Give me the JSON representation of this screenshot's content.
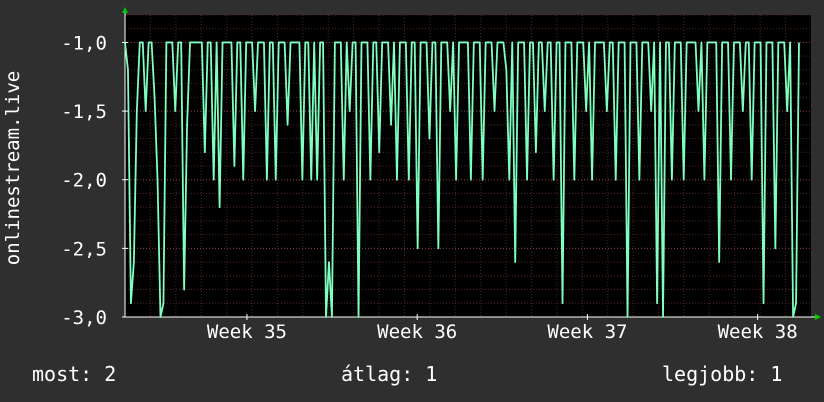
{
  "chart_data": {
    "type": "line",
    "ylabel": "onlinestream.live",
    "ylim": [
      -3.0,
      -0.8
    ],
    "yticks": [
      -1.0,
      -1.5,
      -2.0,
      -2.5,
      -3.0
    ],
    "ytick_labels": [
      "-1,0",
      "-1,5",
      "-2,0",
      "-2,5",
      "-3,0"
    ],
    "x_week_labels": [
      "Week 35",
      "Week 36",
      "Week 37",
      "Week 38"
    ],
    "xlim": [
      0,
      27
    ],
    "week_positions": [
      4.8,
      11.5,
      18.2,
      24.9
    ],
    "grid": true,
    "colors": {
      "background": "#2f2f2f",
      "plot": "#000000",
      "line": "#7fffbf",
      "grid": "#5a2a2a",
      "axis": "#ffffff",
      "arrow": "#00cc00"
    },
    "series": [
      {
        "values": [
          -1.0,
          -1.2,
          -2.9,
          -2.6,
          -1.5,
          -1.0,
          -1.0,
          -1.5,
          -1.0,
          -1.0,
          -1.4,
          -2.0,
          -3.0,
          -2.9,
          -1.0,
          -1.0,
          -1.0,
          -1.5,
          -1.0,
          -1.0,
          -2.8,
          -1.6,
          -1.0,
          -1.0,
          -1.0,
          -1.0,
          -1.0,
          -1.8,
          -1.0,
          -1.0,
          -2.0,
          -1.0,
          -2.2,
          -1.0,
          -1.0,
          -1.0,
          -1.0,
          -1.9,
          -1.0,
          -1.0,
          -2.0,
          -1.0,
          -1.0,
          -1.0,
          -1.5,
          -1.0,
          -1.0,
          -1.0,
          -2.0,
          -1.0,
          -1.0,
          -2.0,
          -1.0,
          -1.0,
          -1.0,
          -1.6,
          -1.0,
          -1.0,
          -1.0,
          -1.0,
          -2.0,
          -1.0,
          -1.0,
          -2.0,
          -1.0,
          -2.0,
          -1.0,
          -1.0,
          -3.0,
          -2.6,
          -3.0,
          -1.0,
          -1.0,
          -1.0,
          -2.0,
          -1.0,
          -1.5,
          -1.0,
          -1.0,
          -3.0,
          -1.0,
          -1.0,
          -1.0,
          -2.0,
          -1.0,
          -1.0,
          -1.8,
          -1.0,
          -1.0,
          -1.0,
          -1.6,
          -1.0,
          -2.0,
          -1.0,
          -1.0,
          -1.0,
          -2.0,
          -1.0,
          -1.0,
          -2.5,
          -1.0,
          -1.0,
          -1.0,
          -1.7,
          -1.0,
          -1.0,
          -2.5,
          -1.0,
          -1.0,
          -1.0,
          -1.5,
          -1.0,
          -2.0,
          -1.0,
          -1.0,
          -1.0,
          -1.0,
          -2.0,
          -1.0,
          -1.0,
          -1.0,
          -2.0,
          -1.0,
          -1.0,
          -1.0,
          -1.5,
          -1.0,
          -1.0,
          -1.0,
          -1.2,
          -2.0,
          -1.0,
          -2.6,
          -1.0,
          -1.0,
          -1.0,
          -2.0,
          -1.0,
          -1.0,
          -1.8,
          -1.0,
          -1.0,
          -1.5,
          -1.0,
          -1.0,
          -2.0,
          -1.0,
          -1.0,
          -2.9,
          -1.0,
          -1.0,
          -1.0,
          -2.0,
          -1.0,
          -1.0,
          -1.0,
          -1.5,
          -1.0,
          -2.0,
          -1.0,
          -1.0,
          -1.0,
          -1.0,
          -1.5,
          -1.0,
          -1.0,
          -2.0,
          -1.0,
          -1.0,
          -1.0,
          -3.0,
          -1.0,
          -1.0,
          -1.0,
          -2.0,
          -1.0,
          -1.0,
          -1.0,
          -1.5,
          -1.0,
          -2.9,
          -1.0,
          -3.0,
          -1.0,
          -1.0,
          -2.0,
          -1.0,
          -1.0,
          -1.0,
          -2.0,
          -1.0,
          -1.0,
          -1.0,
          -1.0,
          -1.5,
          -1.0,
          -2.0,
          -1.0,
          -1.0,
          -1.0,
          -1.0,
          -2.6,
          -1.0,
          -1.0,
          -1.0,
          -2.0,
          -1.0,
          -1.0,
          -1.0,
          -1.5,
          -1.0,
          -1.0,
          -2.0,
          -1.0,
          -1.0,
          -1.0,
          -2.9,
          -1.0,
          -1.0,
          -1.0,
          -2.5,
          -1.0,
          -1.0,
          -1.0,
          -1.5,
          -1.0,
          -3.0,
          -2.9,
          -1.0
        ]
      }
    ]
  },
  "stats": {
    "now": "most: 2",
    "avg": "átlag: 1",
    "max": "legjobb: 1"
  }
}
